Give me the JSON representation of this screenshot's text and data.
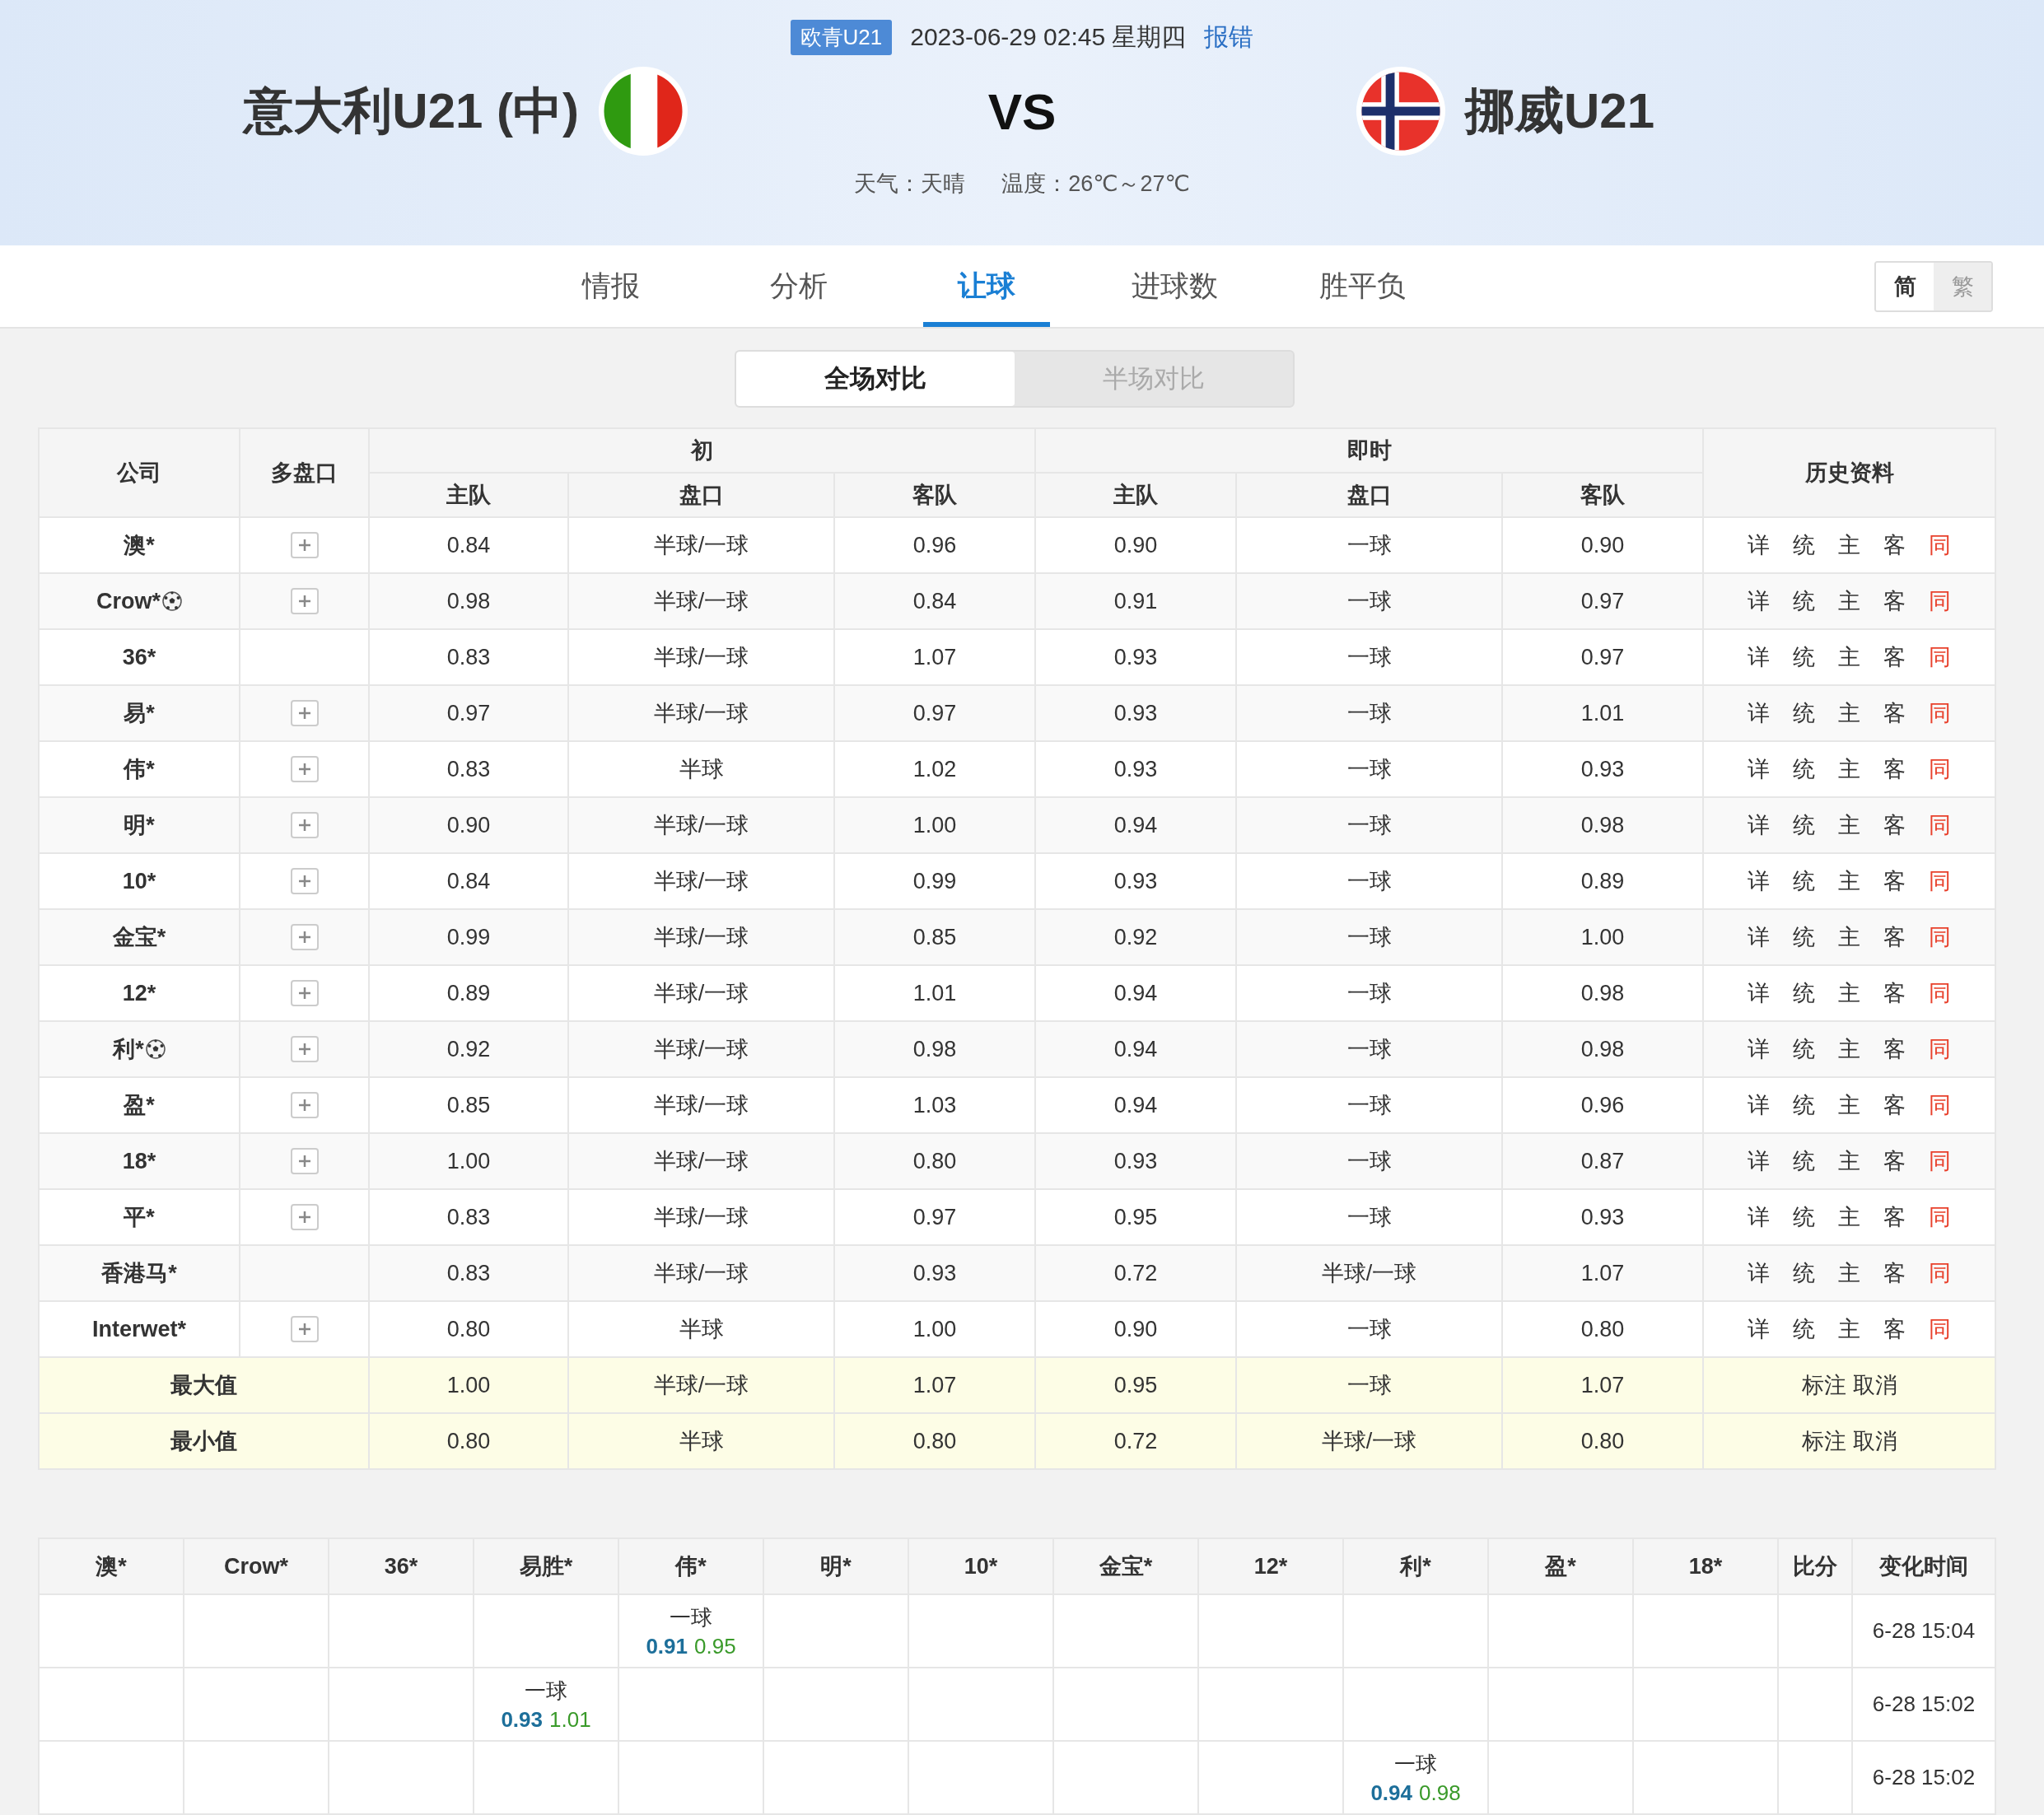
{
  "header": {
    "league_badge": "欧青U21",
    "datetime": "2023-06-29 02:45 星期四",
    "report_link": "报错",
    "home_team": "意大利U21 (中)",
    "vs": "VS",
    "away_team": "挪威U21",
    "weather": "天气：天晴",
    "temperature": "温度：26℃～27℃"
  },
  "tabs": [
    {
      "label": "情报",
      "selected": false
    },
    {
      "label": "分析",
      "selected": false
    },
    {
      "label": "让球",
      "selected": true
    },
    {
      "label": "进球数",
      "selected": false
    },
    {
      "label": "胜平负",
      "selected": false
    }
  ],
  "script_toggle": [
    {
      "label": "简",
      "selected": true
    },
    {
      "label": "繁",
      "selected": false
    }
  ],
  "segments": [
    {
      "label": "全场对比",
      "selected": true
    },
    {
      "label": "半场对比",
      "selected": false
    }
  ],
  "odds_table": {
    "company_header": "公司",
    "multi_header": "多盘口",
    "initial_header": "初",
    "live_header": "即时",
    "history_header": "历史资料",
    "sub_headers": [
      "主队",
      "盘口",
      "客队"
    ],
    "live_sub_headers": [
      "主队",
      "盘口",
      "客队"
    ],
    "rows": [
      {
        "company": "澳*",
        "ball": false,
        "multi": true,
        "initial": [
          "0.84",
          "半球/一球",
          "0.96"
        ],
        "live": [
          "0.90",
          "一球",
          "0.90"
        ],
        "history": [
          {
            "label": "详",
            "kind": "plain"
          },
          {
            "label": "统",
            "kind": "plain"
          },
          {
            "label": "主",
            "kind": "plain"
          },
          {
            "label": "客",
            "kind": "plain"
          },
          {
            "label": "同",
            "kind": "accent"
          }
        ]
      },
      {
        "company": "Crow*",
        "ball": true,
        "multi": true,
        "initial": [
          "0.98",
          "半球/一球",
          "0.84"
        ],
        "live": [
          "0.91",
          "一球",
          "0.97"
        ],
        "history": [
          {
            "label": "详",
            "kind": "plain"
          },
          {
            "label": "统",
            "kind": "plain"
          },
          {
            "label": "主",
            "kind": "plain"
          },
          {
            "label": "客",
            "kind": "plain"
          },
          {
            "label": "同",
            "kind": "accent"
          }
        ]
      },
      {
        "company": "36*",
        "ball": false,
        "multi": false,
        "initial": [
          "0.83",
          "半球/一球",
          "1.07"
        ],
        "live": [
          "0.93",
          "一球",
          "0.97"
        ],
        "history": [
          {
            "label": "详",
            "kind": "plain"
          },
          {
            "label": "统",
            "kind": "plain"
          },
          {
            "label": "主",
            "kind": "plain"
          },
          {
            "label": "客",
            "kind": "plain"
          },
          {
            "label": "同",
            "kind": "accent"
          }
        ]
      },
      {
        "company": "易*",
        "ball": false,
        "multi": true,
        "initial": [
          "0.97",
          "半球/一球",
          "0.97"
        ],
        "live": [
          "0.93",
          "一球",
          "1.01"
        ],
        "history": [
          {
            "label": "详",
            "kind": "plain"
          },
          {
            "label": "统",
            "kind": "plain"
          },
          {
            "label": "主",
            "kind": "plain"
          },
          {
            "label": "客",
            "kind": "plain"
          },
          {
            "label": "同",
            "kind": "accent"
          }
        ]
      },
      {
        "company": "伟*",
        "ball": false,
        "multi": true,
        "initial": [
          "0.83",
          "半球",
          "1.02"
        ],
        "live": [
          "0.93",
          "一球",
          "0.93"
        ],
        "history": [
          {
            "label": "详",
            "kind": "plain"
          },
          {
            "label": "统",
            "kind": "plain"
          },
          {
            "label": "主",
            "kind": "plain"
          },
          {
            "label": "客",
            "kind": "plain"
          },
          {
            "label": "同",
            "kind": "accent"
          }
        ]
      },
      {
        "company": "明*",
        "ball": false,
        "multi": true,
        "initial": [
          "0.90",
          "半球/一球",
          "1.00"
        ],
        "live": [
          "0.94",
          "一球",
          "0.98"
        ],
        "history": [
          {
            "label": "详",
            "kind": "plain"
          },
          {
            "label": "统",
            "kind": "plain"
          },
          {
            "label": "主",
            "kind": "plain"
          },
          {
            "label": "客",
            "kind": "plain"
          },
          {
            "label": "同",
            "kind": "accent"
          }
        ]
      },
      {
        "company": "10*",
        "ball": false,
        "multi": true,
        "initial": [
          "0.84",
          "半球/一球",
          "0.99"
        ],
        "live": [
          "0.93",
          "一球",
          "0.89"
        ],
        "history": [
          {
            "label": "详",
            "kind": "plain"
          },
          {
            "label": "统",
            "kind": "plain"
          },
          {
            "label": "主",
            "kind": "plain"
          },
          {
            "label": "客",
            "kind": "plain"
          },
          {
            "label": "同",
            "kind": "accent"
          }
        ]
      },
      {
        "company": "金宝*",
        "ball": false,
        "multi": true,
        "initial": [
          "0.99",
          "半球/一球",
          "0.85"
        ],
        "live": [
          "0.92",
          "一球",
          "1.00"
        ],
        "history": [
          {
            "label": "详",
            "kind": "plain"
          },
          {
            "label": "统",
            "kind": "plain"
          },
          {
            "label": "主",
            "kind": "plain"
          },
          {
            "label": "客",
            "kind": "plain"
          },
          {
            "label": "同",
            "kind": "accent"
          }
        ]
      },
      {
        "company": "12*",
        "ball": false,
        "multi": true,
        "initial": [
          "0.89",
          "半球/一球",
          "1.01"
        ],
        "live": [
          "0.94",
          "一球",
          "0.98"
        ],
        "history": [
          {
            "label": "详",
            "kind": "plain"
          },
          {
            "label": "统",
            "kind": "plain"
          },
          {
            "label": "主",
            "kind": "plain"
          },
          {
            "label": "客",
            "kind": "plain"
          },
          {
            "label": "同",
            "kind": "accent"
          }
        ]
      },
      {
        "company": "利*",
        "ball": true,
        "multi": true,
        "initial": [
          "0.92",
          "半球/一球",
          "0.98"
        ],
        "live": [
          "0.94",
          "一球",
          "0.98"
        ],
        "history": [
          {
            "label": "详",
            "kind": "plain"
          },
          {
            "label": "统",
            "kind": "plain"
          },
          {
            "label": "主",
            "kind": "plain"
          },
          {
            "label": "客",
            "kind": "plain"
          },
          {
            "label": "同",
            "kind": "accent"
          }
        ]
      },
      {
        "company": "盈*",
        "ball": false,
        "multi": true,
        "initial": [
          "0.85",
          "半球/一球",
          "1.03"
        ],
        "live": [
          "0.94",
          "一球",
          "0.96"
        ],
        "history": [
          {
            "label": "详",
            "kind": "plain"
          },
          {
            "label": "统",
            "kind": "plain"
          },
          {
            "label": "主",
            "kind": "plain"
          },
          {
            "label": "客",
            "kind": "plain"
          },
          {
            "label": "同",
            "kind": "accent"
          }
        ]
      },
      {
        "company": "18*",
        "ball": false,
        "multi": true,
        "initial": [
          "1.00",
          "半球/一球",
          "0.80"
        ],
        "live": [
          "0.93",
          "一球",
          "0.87"
        ],
        "history": [
          {
            "label": "详",
            "kind": "plain"
          },
          {
            "label": "统",
            "kind": "plain"
          },
          {
            "label": "主",
            "kind": "plain"
          },
          {
            "label": "客",
            "kind": "plain"
          },
          {
            "label": "同",
            "kind": "accent"
          }
        ]
      },
      {
        "company": "平*",
        "ball": false,
        "multi": true,
        "initial": [
          "0.83",
          "半球/一球",
          "0.97"
        ],
        "live": [
          "0.95",
          "一球",
          "0.93"
        ],
        "history": [
          {
            "label": "详",
            "kind": "plain"
          },
          {
            "label": "统",
            "kind": "plain"
          },
          {
            "label": "主",
            "kind": "plain"
          },
          {
            "label": "客",
            "kind": "plain"
          },
          {
            "label": "同",
            "kind": "accent"
          }
        ]
      },
      {
        "company": "香港马*",
        "ball": false,
        "multi": false,
        "initial": [
          "0.83",
          "半球/一球",
          "0.93"
        ],
        "live": [
          "0.72",
          "半球/一球",
          "1.07"
        ],
        "history": [
          {
            "label": "详",
            "kind": "plain"
          },
          {
            "label": "统",
            "kind": "plain"
          },
          {
            "label": "主",
            "kind": "plain"
          },
          {
            "label": "客",
            "kind": "plain"
          },
          {
            "label": "同",
            "kind": "accent"
          }
        ]
      },
      {
        "company": "Interwet*",
        "ball": false,
        "multi": true,
        "initial": [
          "0.80",
          "半球",
          "1.00"
        ],
        "live": [
          "0.90",
          "一球",
          "0.80"
        ],
        "history": [
          {
            "label": "详",
            "kind": "plain"
          },
          {
            "label": "统",
            "kind": "plain"
          },
          {
            "label": "主",
            "kind": "plain"
          },
          {
            "label": "客",
            "kind": "plain"
          },
          {
            "label": "同",
            "kind": "accent"
          }
        ]
      }
    ],
    "summary_rows": [
      {
        "label": "最大值",
        "initial": [
          "1.00",
          "半球/一球",
          "1.07"
        ],
        "live": [
          "0.95",
          "一球",
          "1.07"
        ],
        "actions": [
          "标注",
          "取消"
        ]
      },
      {
        "label": "最小值",
        "initial": [
          "0.80",
          "半球",
          "0.80"
        ],
        "live": [
          "0.72",
          "半球/一球",
          "0.80"
        ],
        "actions": [
          "标注",
          "取消"
        ]
      }
    ]
  },
  "changes_table": {
    "columns": [
      "澳*",
      "Crow*",
      "36*",
      "易胜*",
      "伟*",
      "明*",
      "10*",
      "金宝*",
      "12*",
      "利*",
      "盈*",
      "18*"
    ],
    "score_header": "比分",
    "time_header": "变化时间",
    "rows": [
      {
        "cells": [
          null,
          null,
          null,
          null,
          {
            "line": "一球",
            "home": "0.91",
            "away": "0.95"
          },
          null,
          null,
          null,
          null,
          null,
          null,
          null
        ],
        "time": "6-28 15:04"
      },
      {
        "cells": [
          null,
          null,
          null,
          {
            "line": "一球",
            "home": "0.93",
            "away": "1.01"
          },
          null,
          null,
          null,
          null,
          null,
          null,
          null,
          null
        ],
        "time": "6-28 15:02"
      },
      {
        "cells": [
          null,
          null,
          null,
          null,
          null,
          null,
          null,
          null,
          null,
          {
            "line": "一球",
            "home": "0.94",
            "away": "0.98"
          },
          null,
          null
        ],
        "time": "6-28 15:02"
      }
    ]
  }
}
